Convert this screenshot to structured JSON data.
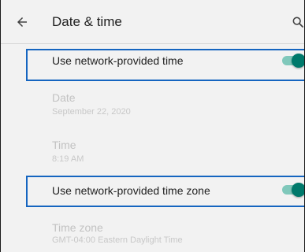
{
  "appbar": {
    "title": "Date & time",
    "back_icon": "arrow-back-icon",
    "search_icon": "search-icon"
  },
  "settings": {
    "network_time": {
      "label": "Use network-provided time",
      "enabled": true
    },
    "date": {
      "label": "Date",
      "summary": "September 22, 2020"
    },
    "time": {
      "label": "Time",
      "summary": "8:19 AM"
    },
    "network_time_zone": {
      "label": "Use network-provided time zone",
      "enabled": true
    },
    "time_zone": {
      "label": "Time zone",
      "summary": "GMT-04:00 Eastern Daylight Time"
    }
  },
  "colors": {
    "switch_thumb": "#00796b",
    "switch_track": "#80c8bb",
    "highlight_border": "#1565c0",
    "background": "#f2f2f2"
  }
}
